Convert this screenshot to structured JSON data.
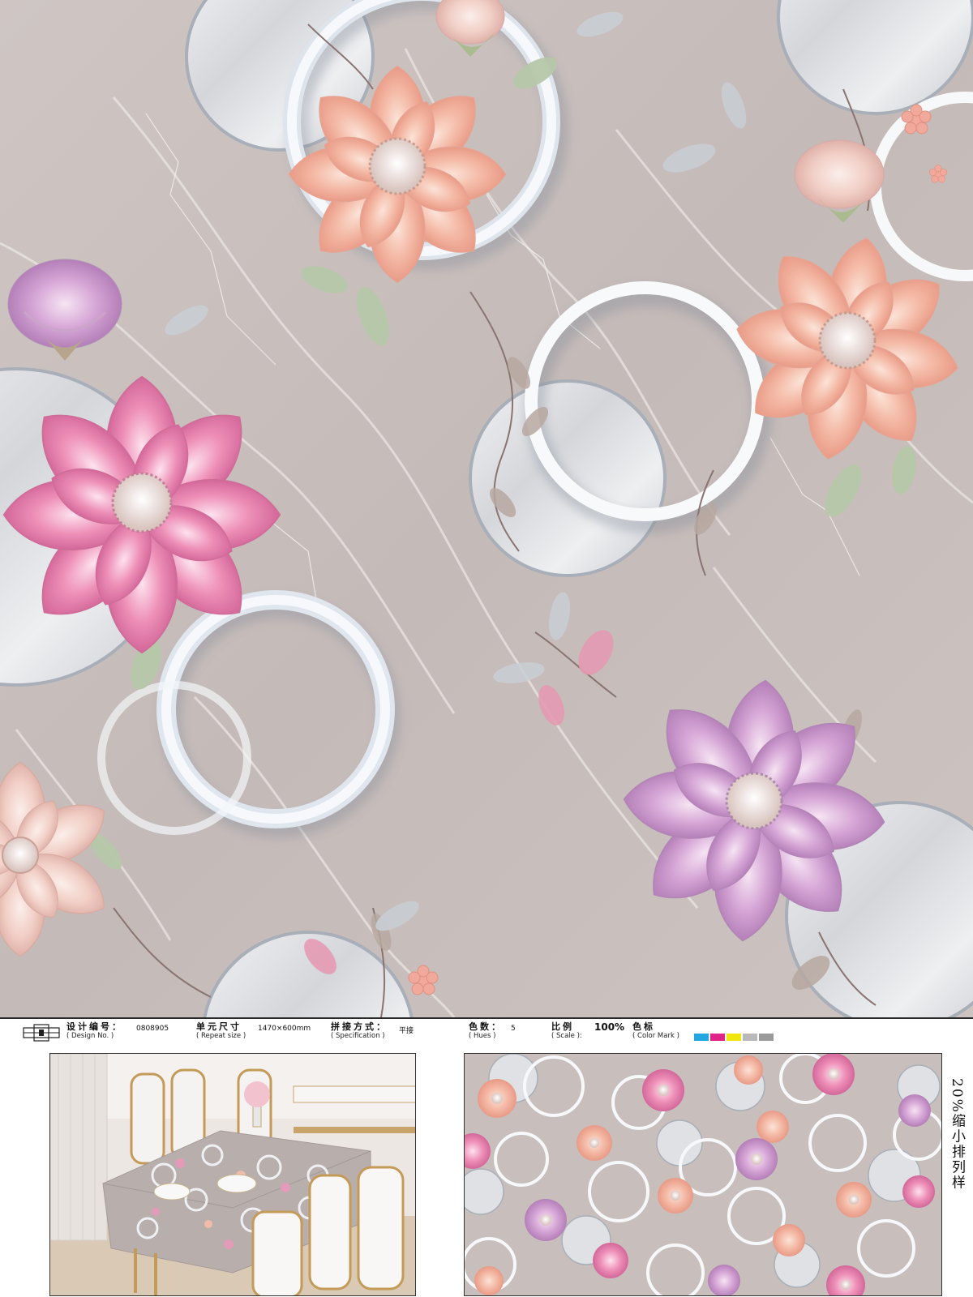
{
  "spec": {
    "design_no_label_cn": "设计编号：",
    "design_no_label_en": "( Design No. )",
    "design_no_value": "0808905",
    "repeat_size_label_cn": "单元尺寸",
    "repeat_size_label_en": "( Repeat size )",
    "repeat_size_value": "1470×600mm",
    "specification_label_cn": "拼接方式：",
    "specification_label_en": "( Specification )",
    "specification_value": "平接",
    "hues_label_cn": "色数：",
    "hues_label_en": "( Hues )",
    "hues_value": "5",
    "scale_label_cn": "比例",
    "scale_label_en": "( Scale ):",
    "scale_value": "100%",
    "color_mark_label_cn": "色标",
    "color_mark_label_en": "( Color Mark )",
    "color_mark_colors": [
      "#22a7e0",
      "#e0248a",
      "#f2e60f",
      "#b9b9b9",
      "#9a9a9a"
    ]
  },
  "repeat_caption": "20%缩小排列样",
  "colors": {
    "marble": "#c9bfbd",
    "marble_vein": "#e9e3e1",
    "ring": "#f3f5f8",
    "ring_shadow": "#9aa4b0",
    "peach": "#f4b6a4",
    "pink": "#e67ea8",
    "lilac": "#c898c8"
  }
}
